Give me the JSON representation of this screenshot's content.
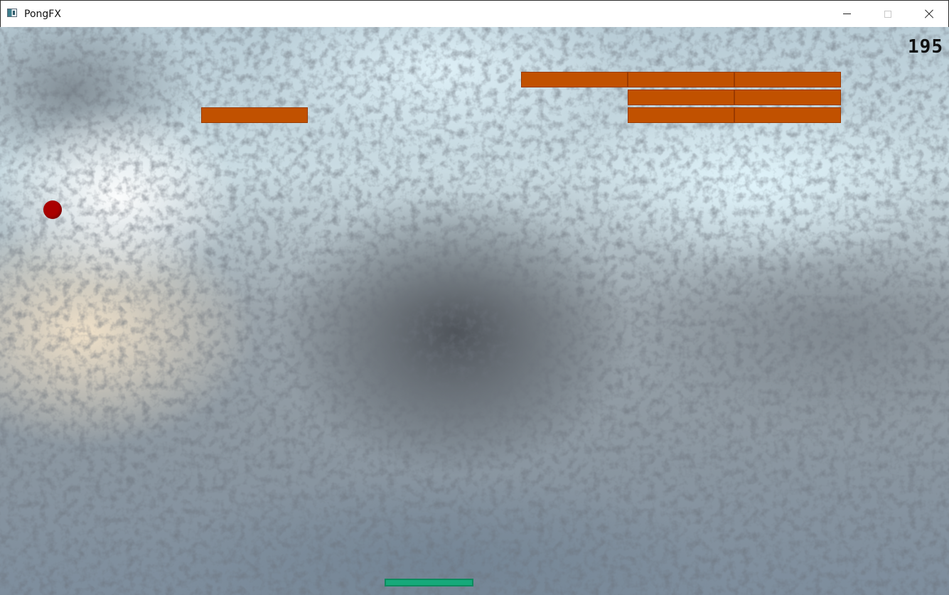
{
  "window": {
    "title": "PongFX",
    "icon": "app-window-icon",
    "controls": {
      "minimize_icon": "minimize-icon",
      "maximize_icon": "maximize-icon",
      "close_icon": "close-icon"
    }
  },
  "game": {
    "score": "195",
    "colors": {
      "brick": "#c15100",
      "brick_border": "#9a3a00",
      "ball": "#aa0000",
      "paddle": "#16a97a"
    },
    "bricks_remaining": 8
  }
}
